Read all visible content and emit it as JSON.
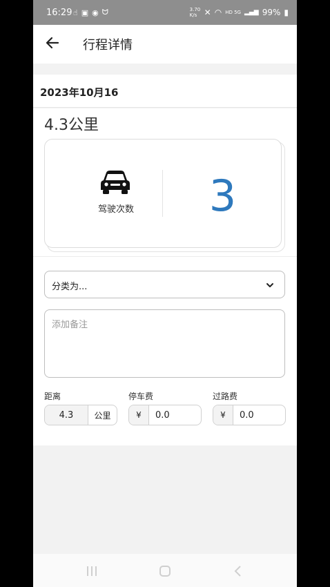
{
  "status_bar": {
    "time": "16:29",
    "net_speed": "3.70 K/s",
    "network": "HD 5G",
    "battery": "99%"
  },
  "app_bar": {
    "title": "行程详情",
    "back_icon": "arrow-left-icon"
  },
  "trip": {
    "date": "2023年10月16",
    "distance_title": "4.3公里",
    "drive_count_label": "驾驶次数",
    "drive_count": "3",
    "car_icon": "car-icon",
    "accent_color": "#2e79bd"
  },
  "category": {
    "placeholder": "分类为...",
    "chevron_icon": "chevron-down-icon"
  },
  "notes": {
    "placeholder": "添加备注",
    "value": ""
  },
  "fields": {
    "distance": {
      "label": "距离",
      "value": "4.3",
      "unit": "公里"
    },
    "parking": {
      "label": "停车费",
      "currency": "¥",
      "value": "0.0"
    },
    "toll": {
      "label": "过路费",
      "currency": "¥",
      "value": "0.0"
    }
  }
}
